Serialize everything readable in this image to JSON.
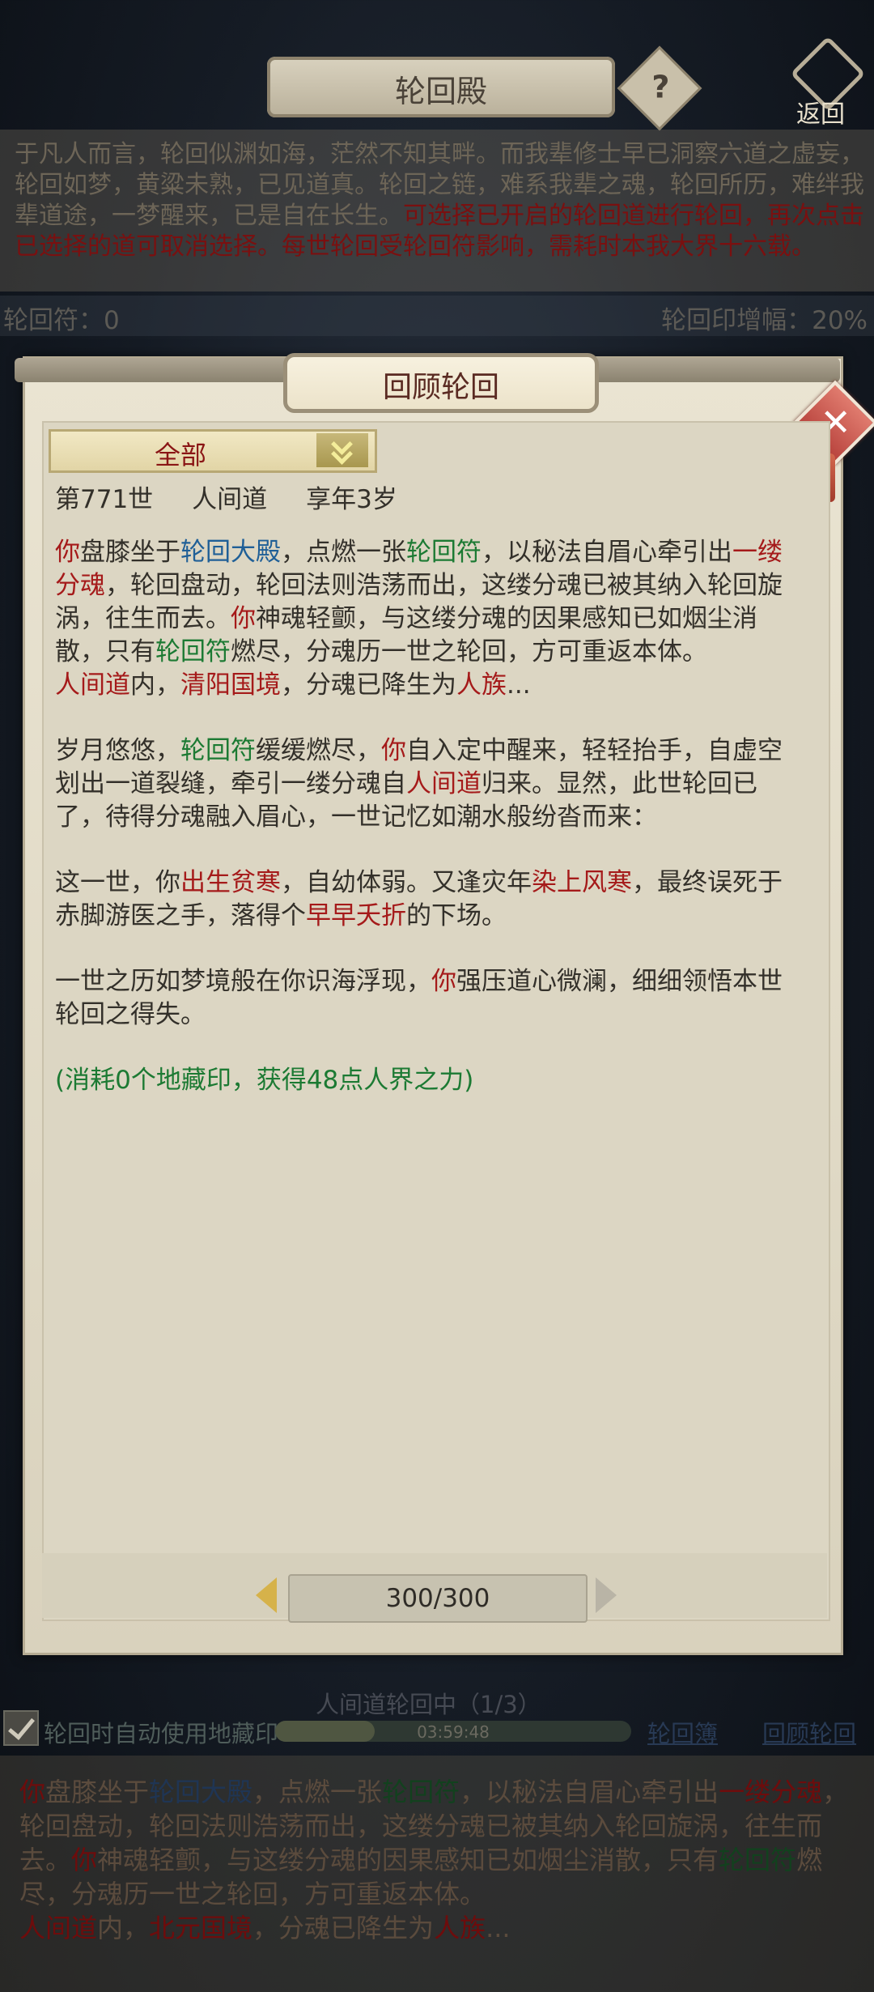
{
  "background": {
    "title": "轮回殿",
    "help_label": "?",
    "back_label": "返回",
    "description": "于凡人而言，轮回似渊如海，茫然不知其畔。而我辈修士早已洞察六道之虚妄，轮回如梦，黄粱未熟，已见道真。轮回之链，难系我辈之魂，轮回所历，难绊我辈道途，一梦醒来，已是自在长生。",
    "description_red": "可选择已开启的轮回道进行轮回，再次点击已选择的道可取消选择。每世轮回受轮回符影响，需耗时本我大界十六载。",
    "fu_label": "轮回符：0",
    "rate_label": "轮回印增幅：20%",
    "ring_status": "人间道轮回中（1/3）",
    "auto_use_label": "轮回时自动使用地藏印",
    "auto_use_checked": true,
    "progress_time": "03:59:48",
    "progress": 0.28,
    "link_book": "轮回簿",
    "link_review": "回顾轮回",
    "story": [
      [
        {
          "t": "你",
          "c": "r"
        },
        {
          "t": "盘膝坐于"
        },
        {
          "t": "轮回大殿",
          "c": "b"
        },
        {
          "t": "，点燃一张"
        },
        {
          "t": "轮回符",
          "c": "g"
        },
        {
          "t": "，以秘法自眉心牵引出"
        },
        {
          "t": "一缕分魂",
          "c": "r"
        },
        {
          "t": "，轮回盘动，轮回法则浩荡而出，这缕分魂已被其纳入轮回旋涡，往生而去。"
        },
        {
          "t": "你",
          "c": "r"
        },
        {
          "t": "神魂轻颤，与这缕分魂的因果感知已如烟尘消散，只有"
        },
        {
          "t": "轮回符",
          "c": "g"
        },
        {
          "t": "燃尽，分魂历一世之轮回，方可重返本体。"
        }
      ],
      [
        {
          "t": "人间道",
          "c": "r"
        },
        {
          "t": "内，"
        },
        {
          "t": "北元国境",
          "c": "r"
        },
        {
          "t": "，分魂已降生为"
        },
        {
          "t": "人族",
          "c": "r"
        },
        {
          "t": "..."
        }
      ]
    ]
  },
  "dialog": {
    "title": "回顾轮回",
    "close_label": "✕",
    "filter_label": "全部",
    "record_header": {
      "life": "第771世",
      "realm": "人间道",
      "age": "享年3岁"
    },
    "paragraphs": [
      [
        {
          "t": "你",
          "c": "red"
        },
        {
          "t": "盘膝坐于"
        },
        {
          "t": "轮回大殿",
          "c": "blu"
        },
        {
          "t": "，点燃一张"
        },
        {
          "t": "轮回符",
          "c": "grn"
        },
        {
          "t": "，以秘法自眉心牵引出"
        },
        {
          "t": "一缕分魂",
          "c": "red"
        },
        {
          "t": "，轮回盘动，轮回法则浩荡而出，这缕分魂已被其纳入轮回旋涡，往生而去。"
        },
        {
          "t": "你",
          "c": "red"
        },
        {
          "t": "神魂轻颤，与这缕分魂的因果感知已如烟尘消散，只有"
        },
        {
          "t": "轮回符",
          "c": "grn"
        },
        {
          "t": "燃尽，分魂历一世之轮回，方可重返本体。"
        }
      ],
      [
        {
          "t": "人间道",
          "c": "red"
        },
        {
          "t": "内，"
        },
        {
          "t": "清阳国境",
          "c": "red"
        },
        {
          "t": "，分魂已降生为"
        },
        {
          "t": "人族",
          "c": "red"
        },
        {
          "t": "..."
        }
      ],
      "gap",
      [
        {
          "t": "岁月悠悠，"
        },
        {
          "t": "轮回符",
          "c": "grn"
        },
        {
          "t": "缓缓燃尽，"
        },
        {
          "t": "你",
          "c": "red"
        },
        {
          "t": "自入定中醒来，轻轻抬手，自虚空划出一道裂缝，牵引一缕分魂自"
        },
        {
          "t": "人间道",
          "c": "red"
        },
        {
          "t": "归来。显然，此世轮回已了，待得分魂融入眉心，一世记忆如潮水般纷沓而来："
        }
      ],
      "gap",
      [
        {
          "t": "这一世，你"
        },
        {
          "t": "出生贫寒",
          "c": "red"
        },
        {
          "t": "，自幼体弱。又逢灾年"
        },
        {
          "t": "染上风寒",
          "c": "red"
        },
        {
          "t": "，最终误死于赤脚游医之手，落得个"
        },
        {
          "t": "早早夭折",
          "c": "red"
        },
        {
          "t": "的下场。"
        }
      ],
      "gap",
      [
        {
          "t": "一世之历如梦境般在你识海浮现，"
        },
        {
          "t": "你",
          "c": "red"
        },
        {
          "t": "强压道心微澜，细细领悟本世轮回之得失。"
        }
      ],
      "gap",
      [
        {
          "t": "(消耗0个地藏印，获得48点人界之力)",
          "c": "grn"
        }
      ]
    ],
    "pager": "300/300"
  }
}
